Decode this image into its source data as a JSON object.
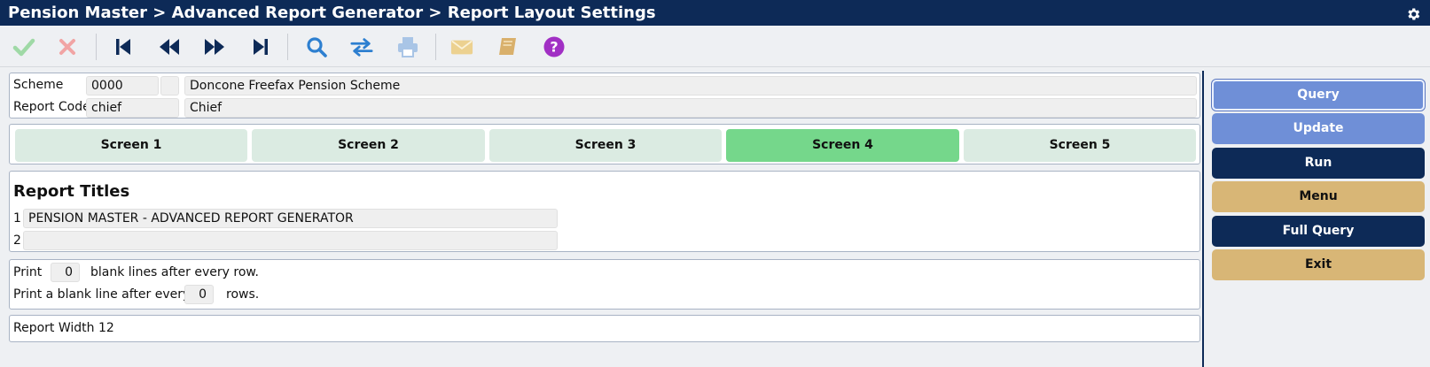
{
  "window": {
    "title": "Pension Master > Advanced Report Generator > Report Layout Settings"
  },
  "toolbar": {
    "icons": [
      "checkmark-icon",
      "cross-icon",
      "first-record-icon",
      "previous-record-icon",
      "next-record-icon",
      "last-record-icon",
      "search-icon",
      "swap-icon",
      "print-icon",
      "mail-icon",
      "book-icon",
      "help-icon"
    ],
    "colors": {
      "check": "#9fd9a6",
      "cross": "#f1a4a4",
      "nav": "#0d2a57",
      "search": "#2d7fd0",
      "swap": "#2d7fd0",
      "print": "#a9c5e6",
      "mail": "#ecd190",
      "book": "#d9b06b",
      "help": "#a12fc4"
    }
  },
  "header_fields": {
    "scheme_label": "Scheme",
    "scheme_code": "0000",
    "scheme_name": "Doncone Freefax Pension Scheme",
    "report_code_label": "Report Code",
    "report_code": "chief",
    "report_name": "Chief"
  },
  "tabs": [
    {
      "label": "Screen 1",
      "active": false
    },
    {
      "label": "Screen 2",
      "active": false
    },
    {
      "label": "Screen 3",
      "active": false
    },
    {
      "label": "Screen 4",
      "active": true
    },
    {
      "label": "Screen 5",
      "active": false
    }
  ],
  "report_titles": {
    "heading": "Report Titles",
    "rows": [
      {
        "index": "1",
        "value": "PENSION MASTER - ADVANCED REPORT GENERATOR"
      },
      {
        "index": "2",
        "value": ""
      }
    ]
  },
  "blank_lines": {
    "print_label": "Print",
    "blank_lines_value": "0",
    "blank_lines_suffix": "blank lines after every row.",
    "every_label": "Print a blank line after every",
    "every_value": "0",
    "every_suffix": "rows."
  },
  "report_width": {
    "text": "Report Width 12"
  },
  "actions": {
    "query": "Query",
    "update": "Update",
    "run": "Run",
    "menu": "Menu",
    "full_query": "Full Query",
    "exit": "Exit"
  },
  "colors": {
    "titlebar": "#0d2a57",
    "tab_active": "#75d78b",
    "tab_inactive": "#dbebe2",
    "button_blue": "#6f8fd7",
    "button_navy": "#0d2a57",
    "button_tan": "#d8b676"
  }
}
